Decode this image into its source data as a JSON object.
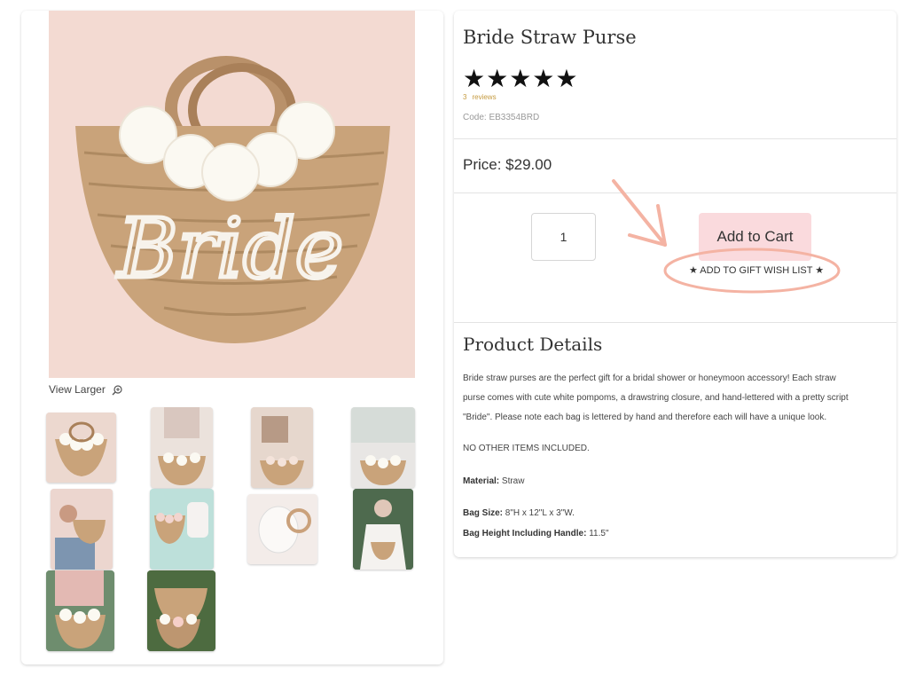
{
  "gallery": {
    "view_larger_label": "View Larger",
    "main_image_word": "Bride",
    "thumbnails_count": 10
  },
  "product": {
    "title": "Bride Straw Purse",
    "rating_stars": "★★★★★",
    "rating_value": 5,
    "reviews_count": "3",
    "reviews_label": "reviews",
    "code": "Code: EB3354BRD",
    "price": "Price: $29.00"
  },
  "cart": {
    "quantity": "1",
    "add_to_cart_label": "Add to Cart",
    "wishlist_label": "★ ADD TO GIFT WISH LIST ★"
  },
  "details": {
    "heading": "Product Details",
    "description_line1": "Bride straw purses are the perfect gift for a bridal shower or honeymoon accessory! Each straw",
    "description_line2": "purse comes with cute white pompoms, a drawstring closure, and hand-lettered with a pretty script",
    "description_line3": "\"Bride\". Please note each bag is lettered by hand and therefore each will have a unique look.",
    "no_other": "NO OTHER ITEMS INCLUDED.",
    "material_label": "Material:",
    "material_value": " Straw",
    "bag_size_label": "Bag Size:",
    "bag_size_value": " 8\"H x 12\"L x 3\"W.",
    "bag_height_label": "Bag Height Including Handle:",
    "bag_height_value": " 11.5\""
  },
  "colors": {
    "add_to_cart_bg": "#fadadd",
    "annotation": "#f4b3a3",
    "reviews_link": "#c59a3f"
  }
}
